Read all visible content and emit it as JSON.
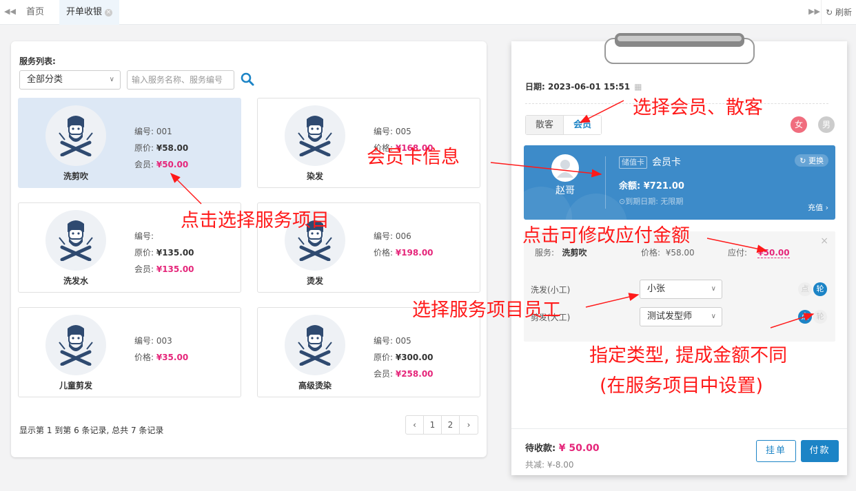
{
  "tabs": {
    "home": "首页",
    "current": "开单收银",
    "refresh": "刷新"
  },
  "service_list": {
    "label": "服务列表:",
    "category": "全部分类",
    "search_placeholder": "输入服务名称、服务编号",
    "cards": [
      {
        "name": "洗剪吹",
        "code": "编号: 001",
        "l2": "原价: ",
        "v2": "¥58.00",
        "l3": "会员: ",
        "v3": "¥50.00",
        "selected": true
      },
      {
        "name": "染发",
        "code": "编号: 005",
        "l2": "价格: ",
        "v2": "¥168.00",
        "l3": "",
        "v3": ""
      },
      {
        "name": "洗发水",
        "code": "编号:",
        "l2": "原价: ",
        "v2": "¥135.00",
        "l3": "会员: ",
        "v3": "¥135.00"
      },
      {
        "name": "烫发",
        "code": "编号: 006",
        "l2": "价格: ",
        "v2": "¥198.00",
        "l3": "",
        "v3": ""
      },
      {
        "name": "儿童剪发",
        "code": "编号: 003",
        "l2": "价格: ",
        "v2": "¥35.00",
        "l3": "",
        "v3": ""
      },
      {
        "name": "高级烫染",
        "code": "编号: 005",
        "l2": "原价: ",
        "v2": "¥300.00",
        "l3": "会员: ",
        "v3": "¥258.00"
      }
    ],
    "records": "显示第 1 到第 6 条记录, 总共 7 条记录",
    "pager": [
      "‹",
      "1",
      "2",
      "›"
    ]
  },
  "order": {
    "date_label": "日期: 2023-06-01 15:51",
    "guest_tab": "散客",
    "member_tab": "会员",
    "female": "女",
    "male": "男",
    "member_card": {
      "name": "赵哥",
      "type_tag": "储值卡",
      "card_name": "会员卡",
      "balance": "余额: ¥721.00",
      "expiry": "⊙到期日期: 无限期",
      "change": "更换",
      "recharge": "充值"
    },
    "service": {
      "label": "服务:",
      "name": "洗剪吹",
      "price_label": "价格:",
      "price": "¥58.00",
      "pay_label": "应付:",
      "pay": "¥50.00"
    },
    "staff": [
      {
        "role": "洗发(小工)",
        "person": "小张",
        "dian": "点",
        "lun": "轮",
        "mode": "lun"
      },
      {
        "role": "剪发(大工)",
        "person": "测试发型师",
        "dian": "点",
        "lun": "轮",
        "mode": "dian"
      }
    ],
    "due_label": "待收款:",
    "due_amount": "¥ 50.00",
    "saved": "共减: ¥-8.00",
    "hold": "挂单",
    "pay": "付款"
  },
  "annotations": {
    "select_member": "选择会员、散客",
    "card_info": "会员卡信息",
    "select_service": "点击选择服务项目",
    "edit_amount": "点击可修改应付金额",
    "select_staff": "选择服务项目员工",
    "type_note_1": "指定类型, 提成金额不同",
    "type_note_2": "(在服务项目中设置)"
  },
  "colors": {
    "accent": "#1c84c6",
    "price": "#e5267a",
    "annotation": "#ff1a1a",
    "member_card": "#3d8bc9"
  }
}
